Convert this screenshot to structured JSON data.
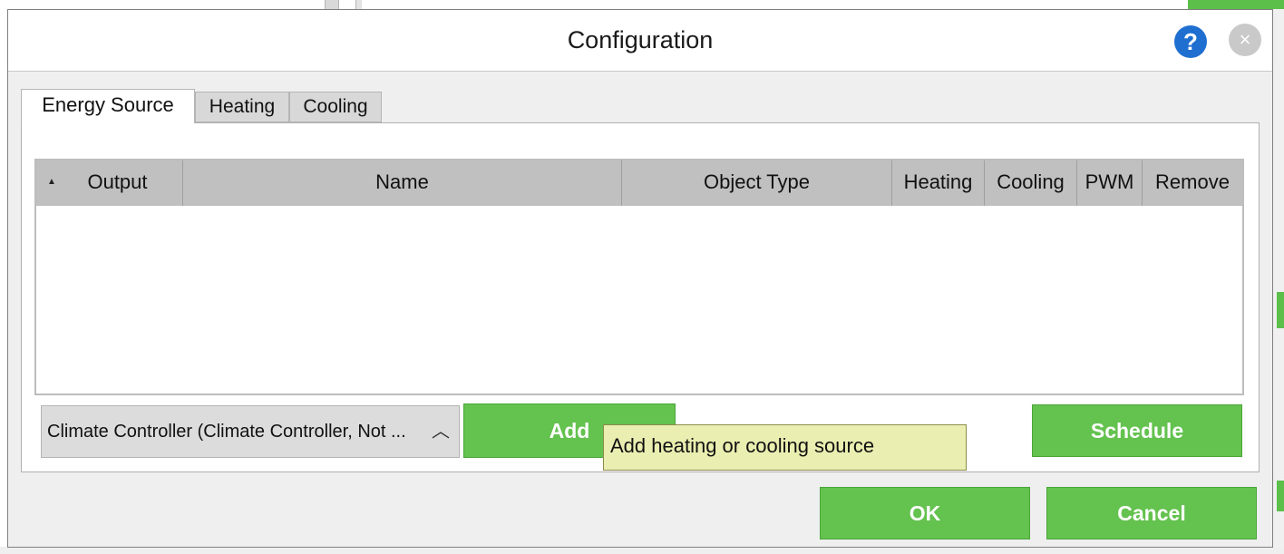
{
  "dialog": {
    "title": "Configuration",
    "help_symbol": "?",
    "close_symbol": "×"
  },
  "tabs": [
    {
      "label": "Energy Source",
      "active": true
    },
    {
      "label": "Heating",
      "active": false
    },
    {
      "label": "Cooling",
      "active": false
    }
  ],
  "table": {
    "sort_indicator": "▲",
    "columns": [
      "Output",
      "Name",
      "Object Type",
      "Heating",
      "Cooling",
      "PWM",
      "Remove"
    ],
    "rows": []
  },
  "controls": {
    "source_select_value": "Climate Controller (Climate Controller, Not ...",
    "source_select_chevron": "︿",
    "add_label": "Add",
    "schedule_label": "Schedule",
    "ok_label": "OK",
    "cancel_label": "Cancel"
  },
  "tooltip": {
    "text": "Add heating or cooling source"
  },
  "colors": {
    "accent_green": "#64c24f",
    "help_blue": "#1f6fd1",
    "tooltip_bg": "#eaeeb0"
  }
}
